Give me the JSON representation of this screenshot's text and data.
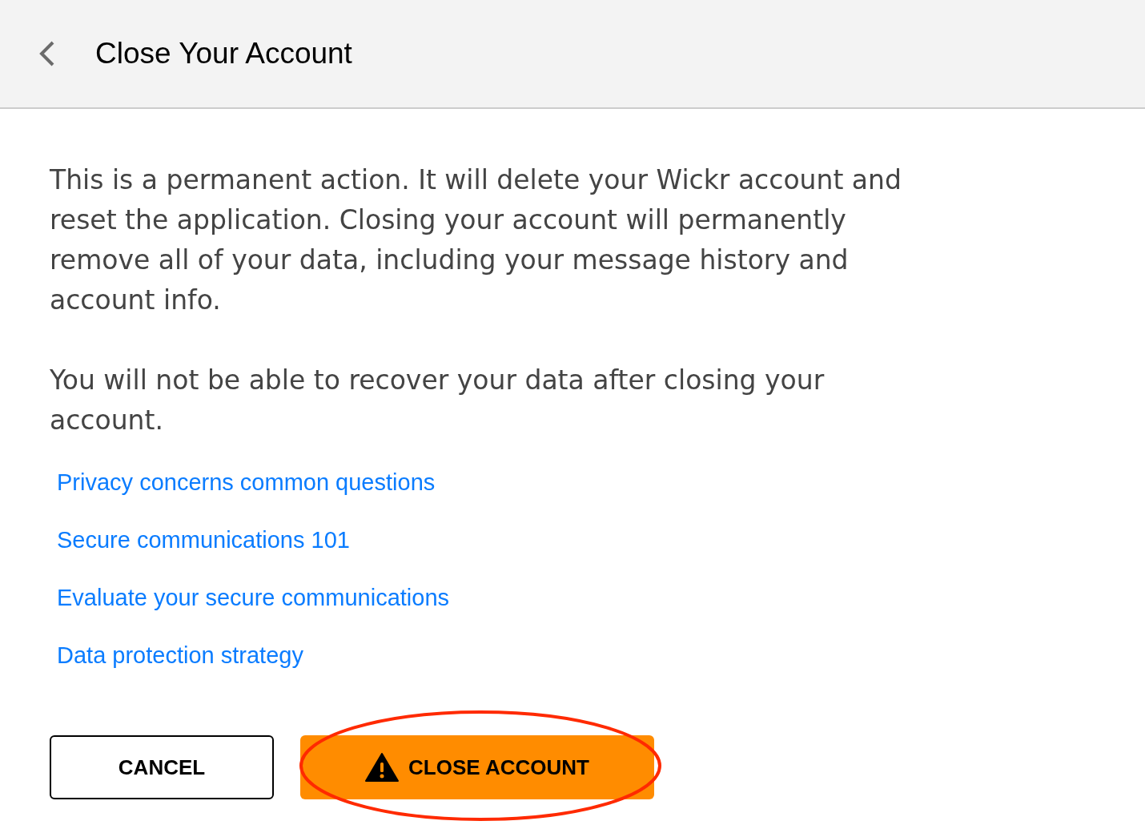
{
  "header": {
    "title": "Close Your Account"
  },
  "paragraphs": [
    "This is a permanent action. It will delete your Wickr account and reset the application. Closing your account will permanently remove all of your data, including your message history and account info.",
    "You will not be able to recover your data after closing your account."
  ],
  "links": [
    {
      "label": "Privacy concerns common questions"
    },
    {
      "label": "Secure communications 101"
    },
    {
      "label": "Evaluate your secure communications"
    },
    {
      "label": "Data protection strategy"
    }
  ],
  "buttons": [
    {
      "kind": "secondary",
      "label": "CANCEL",
      "highlighted": false
    },
    {
      "kind": "danger",
      "label": "CLOSE ACCOUNT",
      "highlighted": true
    }
  ]
}
